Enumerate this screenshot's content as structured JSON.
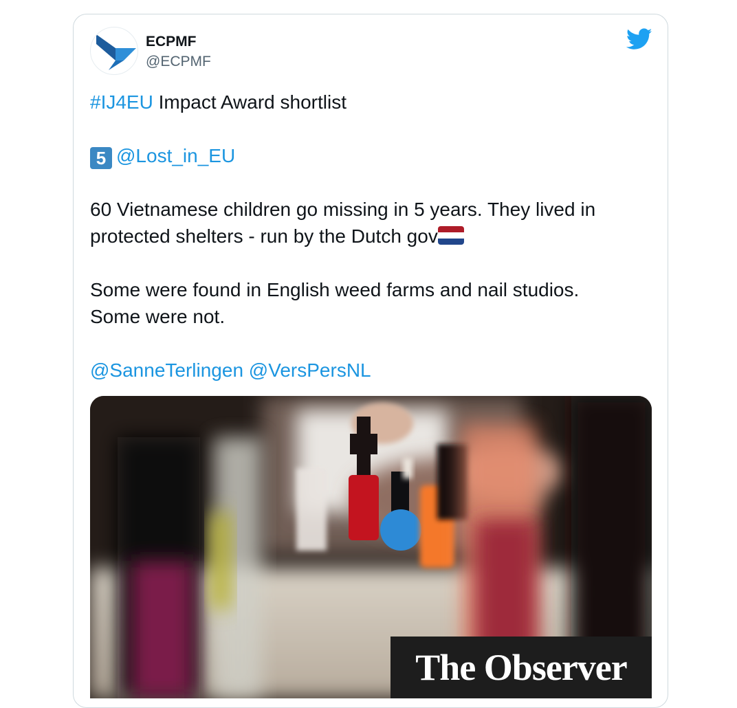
{
  "tweet": {
    "author_name": "ECPMF",
    "author_handle": "@ECPMF",
    "hashtag": "#IJ4EU",
    "line1_rest": " Impact Award shortlist",
    "keycap_digit": "5",
    "mention_lost": "@Lost_in_EU",
    "para1": "60 Vietnamese children go missing in 5 years. They lived in protected shelters - run by the Dutch gov",
    "para2_line1": "Some were found in English weed farms and nail studios.",
    "para2_line2": "Some were not.",
    "mention_sanne": "@SanneTerlingen",
    "mention_verspers": "@VersPersNL"
  },
  "media": {
    "brand_label": "The Observer"
  },
  "icons": {
    "platform": "twitter-bird-icon",
    "flag": "netherlands-flag-icon",
    "keycap": "keycap-5-icon"
  },
  "colors": {
    "link": "#1b95e0",
    "twitter_blue": "#1da1f2",
    "avatar_blue_dark": "#1d5c9c",
    "avatar_blue_light": "#2f8fd8"
  }
}
